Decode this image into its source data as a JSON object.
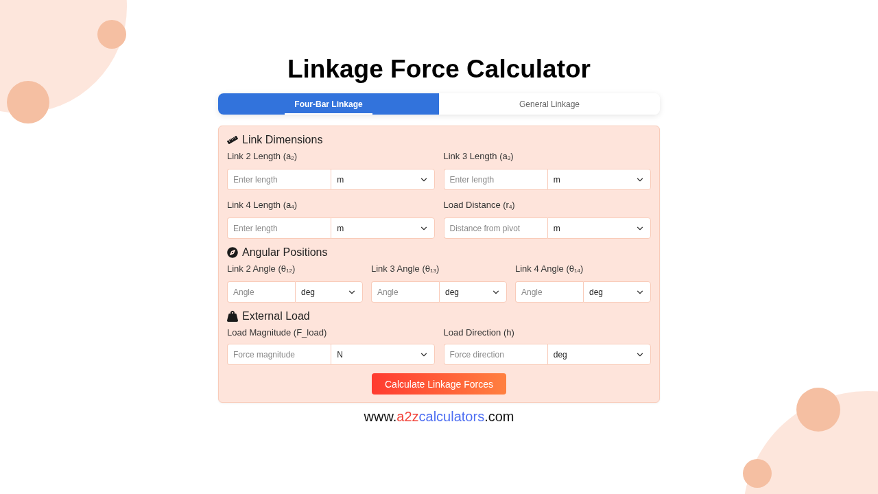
{
  "title": "Linkage Force Calculator",
  "tabs": [
    {
      "label": "Four-Bar Linkage",
      "selected": true
    },
    {
      "label": "General Linkage",
      "selected": false
    }
  ],
  "sections": [
    {
      "heading": "Link Dimensions",
      "fields": [
        {
          "label": "Link 2 Length (a$_{2}$)",
          "placeholder": "Enter length",
          "unit": "m"
        },
        {
          "label": "Link 3 Length (a$_{3}$)",
          "placeholder": "Enter length",
          "unit": "m"
        },
        {
          "label": "Link 4 Length (a$_{4}$)",
          "placeholder": "Enter length",
          "unit": "m"
        },
        {
          "label": "Load Distance (r$_{4}$)",
          "placeholder": "Distance from pivot",
          "unit": "m"
        }
      ]
    },
    {
      "heading": "Angular Positions",
      "fields": [
        {
          "label": "Link 2 Angle (θ$_{12}$)",
          "placeholder": "Angle",
          "unit": "deg"
        },
        {
          "label": "Link 3 Angle (θ$_{13}$)",
          "placeholder": "Angle",
          "unit": "deg"
        },
        {
          "label": "Link 4 Angle (θ$_{14}$)",
          "placeholder": "Angle",
          "unit": "deg"
        }
      ]
    },
    {
      "heading": "External Load",
      "fields": [
        {
          "label": "Load Magnitude (F_load)",
          "placeholder": "Force magnitude",
          "unit": "N"
        },
        {
          "label": "Load Direction (h)",
          "placeholder": "Force direction",
          "unit": "deg"
        }
      ]
    }
  ],
  "button": {
    "label": "Calculate Linkage Forces"
  },
  "footer": {
    "parts": [
      {
        "text": "www.",
        "color": "#111111"
      },
      {
        "text": "a2z",
        "color": "#f2433a"
      },
      {
        "text": "calculators",
        "color": "#4d6ef2"
      },
      {
        "text": ".com",
        "color": "#111111"
      }
    ]
  }
}
